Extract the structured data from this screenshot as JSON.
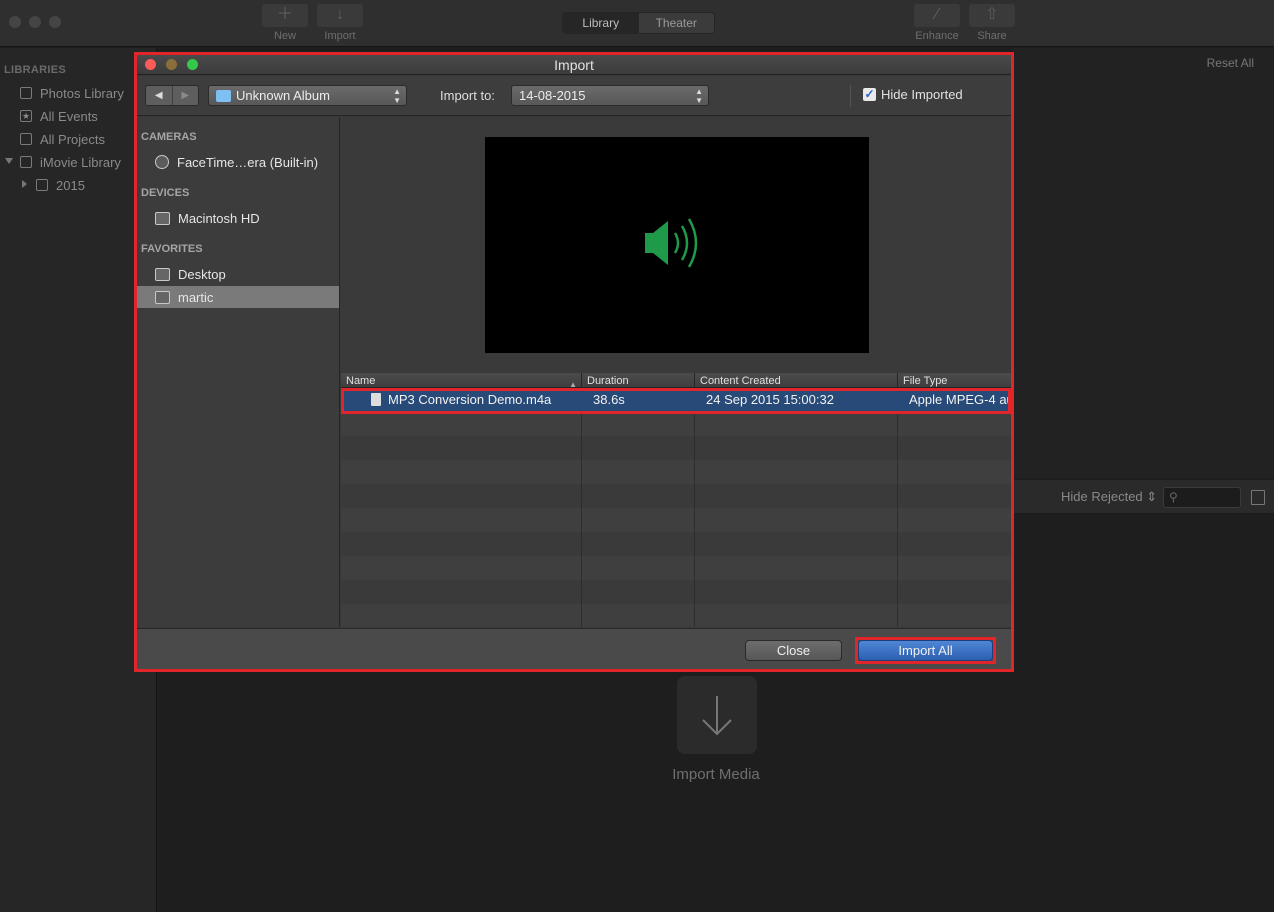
{
  "app": {
    "toolbar": {
      "new_label": "New",
      "import_label": "Import",
      "enhance_label": "Enhance",
      "share_label": "Share",
      "segments": [
        "Library",
        "Theater"
      ]
    },
    "sidebar": {
      "heading": "LIBRARIES",
      "items": [
        {
          "label": "Photos Library",
          "icon": "photos-icon"
        },
        {
          "label": "All Events",
          "icon": "star-icon"
        },
        {
          "label": "All Projects",
          "icon": "projects-icon"
        },
        {
          "label": "iMovie Library",
          "icon": "library-icon"
        },
        {
          "label": "2015",
          "icon": "event-icon"
        }
      ]
    },
    "reset_all": "Reset All",
    "hide_rejected": "Hide Rejected ⇕",
    "import_media": "Import Media"
  },
  "dialog": {
    "title": "Import",
    "album_popup": "Unknown Album",
    "import_to_label": "Import to:",
    "import_to_value": "14-08-2015",
    "hide_imported_label": "Hide Imported",
    "hide_imported_checked": true,
    "sources": {
      "cameras_heading": "CAMERAS",
      "camera": "FaceTime…era (Built-in)",
      "devices_heading": "DEVICES",
      "device": "Macintosh HD",
      "favorites_heading": "FAVORITES",
      "favorites": [
        "Desktop",
        "martic"
      ]
    },
    "table": {
      "columns": [
        "Name",
        "Duration",
        "Content Created",
        "File Type"
      ],
      "rows": [
        {
          "name": "MP3 Conversion Demo.m4a",
          "duration": "38.6s",
          "created": "24 Sep 2015 15:00:32",
          "type": "Apple MPEG-4 au"
        }
      ]
    },
    "buttons": {
      "close": "Close",
      "import_all": "Import All"
    },
    "colors": {
      "accent": "#2c5fb0",
      "highlight": "#e0262a",
      "speaker": "#1f9a48"
    }
  }
}
